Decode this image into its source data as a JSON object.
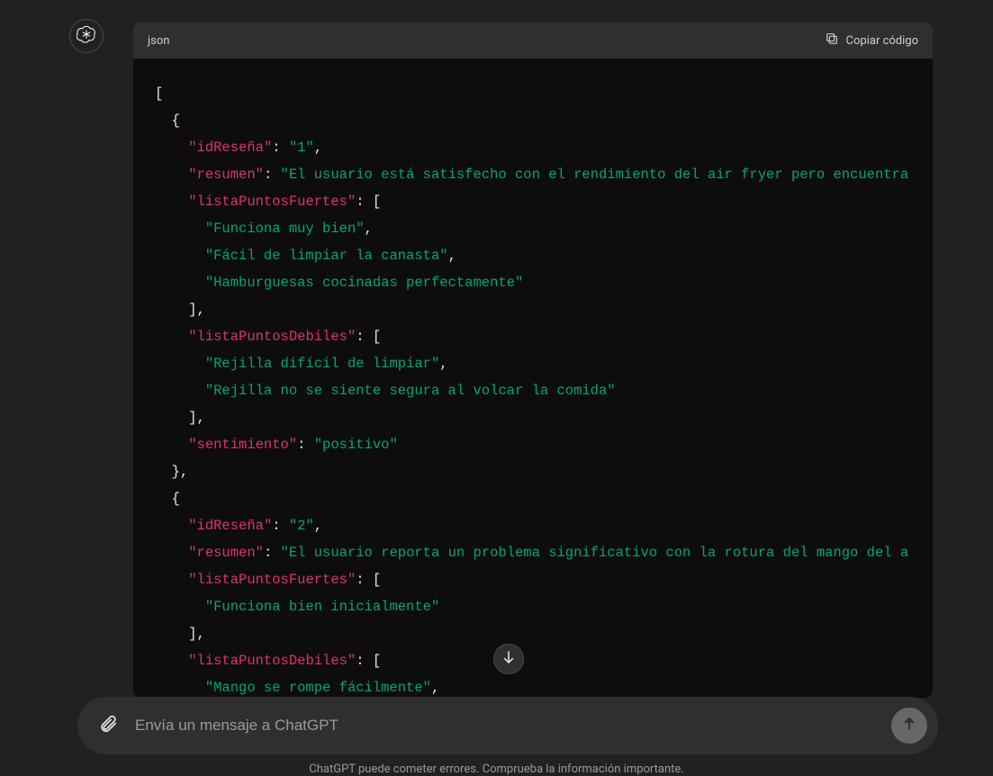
{
  "avatar": {
    "icon_name": "openai-logo-icon"
  },
  "code_block": {
    "language_label": "json",
    "copy_label": "Copiar código",
    "lines": [
      {
        "indent": 0,
        "segs": [
          {
            "t": "p",
            "v": "["
          }
        ]
      },
      {
        "indent": 1,
        "segs": [
          {
            "t": "p",
            "v": "{"
          }
        ]
      },
      {
        "indent": 2,
        "segs": [
          {
            "t": "k",
            "v": "\"idReseña\""
          },
          {
            "t": "p",
            "v": ": "
          },
          {
            "t": "s",
            "v": "\"1\""
          },
          {
            "t": "p",
            "v": ","
          }
        ]
      },
      {
        "indent": 2,
        "segs": [
          {
            "t": "k",
            "v": "\"resumen\""
          },
          {
            "t": "p",
            "v": ": "
          },
          {
            "t": "s",
            "v": "\"El usuario está satisfecho con el rendimiento del air fryer pero encuentra"
          }
        ]
      },
      {
        "indent": 2,
        "segs": [
          {
            "t": "k",
            "v": "\"listaPuntosFuertes\""
          },
          {
            "t": "p",
            "v": ": ["
          }
        ]
      },
      {
        "indent": 3,
        "segs": [
          {
            "t": "s",
            "v": "\"Funciona muy bien\""
          },
          {
            "t": "p",
            "v": ","
          }
        ]
      },
      {
        "indent": 3,
        "segs": [
          {
            "t": "s",
            "v": "\"Fácil de limpiar la canasta\""
          },
          {
            "t": "p",
            "v": ","
          }
        ]
      },
      {
        "indent": 3,
        "segs": [
          {
            "t": "s",
            "v": "\"Hamburguesas cocinadas perfectamente\""
          }
        ]
      },
      {
        "indent": 2,
        "segs": [
          {
            "t": "p",
            "v": "],"
          }
        ]
      },
      {
        "indent": 2,
        "segs": [
          {
            "t": "k",
            "v": "\"listaPuntosDebiles\""
          },
          {
            "t": "p",
            "v": ": ["
          }
        ]
      },
      {
        "indent": 3,
        "segs": [
          {
            "t": "s",
            "v": "\"Rejilla difícil de limpiar\""
          },
          {
            "t": "p",
            "v": ","
          }
        ]
      },
      {
        "indent": 3,
        "segs": [
          {
            "t": "s",
            "v": "\"Rejilla no se siente segura al volcar la comida\""
          }
        ]
      },
      {
        "indent": 2,
        "segs": [
          {
            "t": "p",
            "v": "],"
          }
        ]
      },
      {
        "indent": 2,
        "segs": [
          {
            "t": "k",
            "v": "\"sentimiento\""
          },
          {
            "t": "p",
            "v": ": "
          },
          {
            "t": "s",
            "v": "\"positivo\""
          }
        ]
      },
      {
        "indent": 1,
        "segs": [
          {
            "t": "p",
            "v": "},"
          }
        ]
      },
      {
        "indent": 1,
        "segs": [
          {
            "t": "p",
            "v": "{"
          }
        ]
      },
      {
        "indent": 2,
        "segs": [
          {
            "t": "k",
            "v": "\"idReseña\""
          },
          {
            "t": "p",
            "v": ": "
          },
          {
            "t": "s",
            "v": "\"2\""
          },
          {
            "t": "p",
            "v": ","
          }
        ]
      },
      {
        "indent": 2,
        "segs": [
          {
            "t": "k",
            "v": "\"resumen\""
          },
          {
            "t": "p",
            "v": ": "
          },
          {
            "t": "s",
            "v": "\"El usuario reporta un problema significativo con la rotura del mango del a"
          }
        ]
      },
      {
        "indent": 2,
        "segs": [
          {
            "t": "k",
            "v": "\"listaPuntosFuertes\""
          },
          {
            "t": "p",
            "v": ": ["
          }
        ]
      },
      {
        "indent": 3,
        "segs": [
          {
            "t": "s",
            "v": "\"Funciona bien inicialmente\""
          }
        ]
      },
      {
        "indent": 2,
        "segs": [
          {
            "t": "p",
            "v": "],"
          }
        ]
      },
      {
        "indent": 2,
        "segs": [
          {
            "t": "k",
            "v": "\"listaPuntosDebiles\""
          },
          {
            "t": "p",
            "v": ": ["
          }
        ]
      },
      {
        "indent": 3,
        "segs": [
          {
            "t": "s",
            "v": "\"Mango se rompe fácilmente\""
          },
          {
            "t": "p",
            "v": ","
          }
        ]
      }
    ]
  },
  "composer": {
    "placeholder": "Envía un mensaje a ChatGPT",
    "value": ""
  },
  "disclaimer": "ChatGPT puede cometer errores. Comprueba la información importante.",
  "colors": {
    "bg": "#212121",
    "code_bg": "#0d0d0d",
    "header_bg": "#2f2f2f",
    "key": "#df3079",
    "string": "#00a67d",
    "punct": "#e6e6e6"
  }
}
